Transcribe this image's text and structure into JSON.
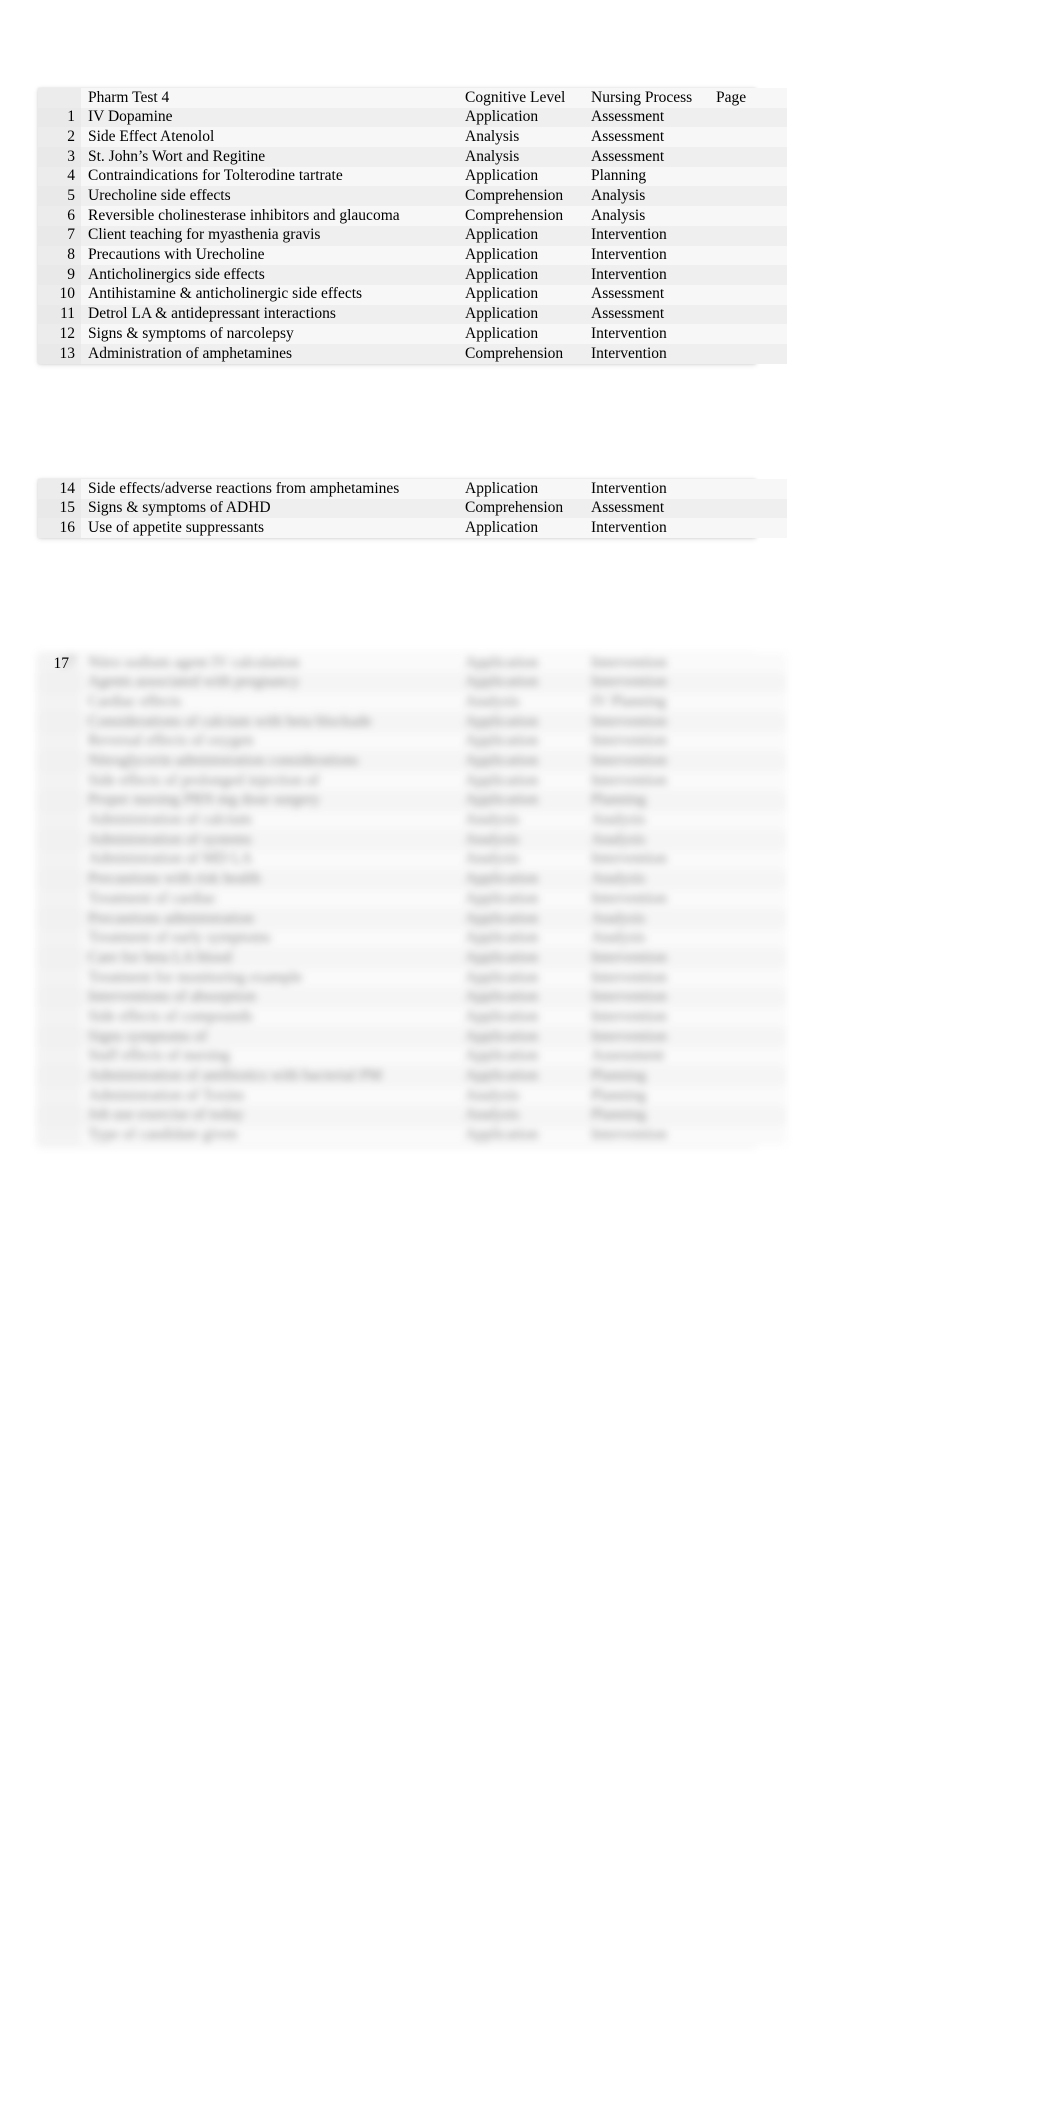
{
  "document": {
    "columns": [
      "",
      "Pharm Test 4",
      "Cognitive Level",
      "Nursing Process",
      "Page"
    ],
    "header": {
      "num": "",
      "title": "Pharm Test 4",
      "cognitive": "Cognitive Level",
      "nursing": "Nursing Process",
      "page": "Page"
    }
  },
  "table1": {
    "rows": [
      {
        "num": "1",
        "item": "IV Dopamine",
        "cognitive": "Application",
        "nursing": "Assessment",
        "page": ""
      },
      {
        "num": "2",
        "item": "Side Effect Atenolol",
        "cognitive": "Analysis",
        "nursing": "Assessment",
        "page": ""
      },
      {
        "num": "3",
        "item": "St. John’s Wort and Regitine",
        "cognitive": "Analysis",
        "nursing": "Assessment",
        "page": ""
      },
      {
        "num": "4",
        "item": "Contraindications for Tolterodine tartrate",
        "cognitive": "Application",
        "nursing": "Planning",
        "page": ""
      },
      {
        "num": "5",
        "item": "Urecholine side effects",
        "cognitive": "Comprehension",
        "nursing": "Analysis",
        "page": ""
      },
      {
        "num": "6",
        "item": "Reversible cholinesterase inhibitors and glaucoma",
        "cognitive": "Comprehension",
        "nursing": "Analysis",
        "page": ""
      },
      {
        "num": "7",
        "item": "Client teaching for myasthenia gravis",
        "cognitive": "Application",
        "nursing": "Intervention",
        "page": ""
      },
      {
        "num": "8",
        "item": "Precautions with Urecholine",
        "cognitive": "Application",
        "nursing": "Intervention",
        "page": ""
      },
      {
        "num": "9",
        "item": "Anticholinergics side effects",
        "cognitive": "Application",
        "nursing": "Intervention",
        "page": ""
      },
      {
        "num": "10",
        "item": "Antihistamine & anticholinergic side effects",
        "cognitive": "Application",
        "nursing": "Assessment",
        "page": ""
      },
      {
        "num": "11",
        "item": "Detrol LA & antidepressant interactions",
        "cognitive": "Application",
        "nursing": "Assessment",
        "page": ""
      },
      {
        "num": "12",
        "item": "Signs & symptoms of narcolepsy",
        "cognitive": "Application",
        "nursing": "Intervention",
        "page": ""
      },
      {
        "num": "13",
        "item": "Administration of amphetamines",
        "cognitive": "Comprehension",
        "nursing": "Intervention",
        "page": ""
      }
    ]
  },
  "table2": {
    "rows": [
      {
        "num": "14",
        "item": "Side effects/adverse reactions from amphetamines",
        "cognitive": "Application",
        "nursing": "Intervention",
        "page": ""
      },
      {
        "num": "15",
        "item": "Signs & symptoms of ADHD",
        "cognitive": "Comprehension",
        "nursing": "Assessment",
        "page": ""
      },
      {
        "num": "16",
        "item": "Use of appetite suppressants",
        "cognitive": "Application",
        "nursing": "Intervention",
        "page": ""
      }
    ]
  },
  "table3": {
    "note": "blurred",
    "first_visible_num": "17",
    "rows": [
      {
        "num": "17",
        "item": "Nitro sodium agent IV calculation",
        "cognitive": "Application",
        "nursing": "Intervention",
        "page": ""
      },
      {
        "num": "",
        "item": "Agents associated with pregnancy",
        "cognitive": "Application",
        "nursing": "Intervention",
        "page": ""
      },
      {
        "num": "",
        "item": "Cardiac effects",
        "cognitive": "Analysis",
        "nursing": "IV Planning",
        "page": ""
      },
      {
        "num": "",
        "item": "Considerations of calcium with beta blockade",
        "cognitive": "Application",
        "nursing": "Intervention",
        "page": ""
      },
      {
        "num": "",
        "item": "Reversal effects of oxygen",
        "cognitive": "Application",
        "nursing": "Intervention",
        "page": ""
      },
      {
        "num": "",
        "item": "Nitroglycerin administration considerations",
        "cognitive": "Application",
        "nursing": "Intervention",
        "page": ""
      },
      {
        "num": "",
        "item": "Side effects of prolonged injection of",
        "cognitive": "Application",
        "nursing": "Intervention",
        "page": ""
      },
      {
        "num": "",
        "item": "Proper nursing PRN mg dose surgery",
        "cognitive": "Application",
        "nursing": "Planning",
        "page": ""
      },
      {
        "num": "",
        "item": "Administration of calcium",
        "cognitive": "Analysis",
        "nursing": "Analysis",
        "page": ""
      },
      {
        "num": "",
        "item": "Administration of systems",
        "cognitive": "Analysis",
        "nursing": "Analysis",
        "page": ""
      },
      {
        "num": "",
        "item": "Administration of MD LA",
        "cognitive": "Analysis",
        "nursing": "Intervention",
        "page": ""
      },
      {
        "num": "",
        "item": "Precautions with risk health",
        "cognitive": "Application",
        "nursing": "Analysis",
        "page": ""
      },
      {
        "num": "",
        "item": "Treatment of cardiac",
        "cognitive": "Application",
        "nursing": "Intervention",
        "page": ""
      },
      {
        "num": "",
        "item": "Precautions administration",
        "cognitive": "Application",
        "nursing": "Analysis",
        "page": ""
      },
      {
        "num": "",
        "item": "Treatment of early symptoms",
        "cognitive": "Application",
        "nursing": "Analysis",
        "page": ""
      },
      {
        "num": "",
        "item": "Care for beta LA blood",
        "cognitive": "Application",
        "nursing": "Intervention",
        "page": ""
      },
      {
        "num": "",
        "item": "Treatment for monitoring example",
        "cognitive": "Application",
        "nursing": "Intervention",
        "page": ""
      },
      {
        "num": "",
        "item": "Interventions of absorption",
        "cognitive": "Application",
        "nursing": "Intervention",
        "page": ""
      },
      {
        "num": "",
        "item": "Side effects of compounds",
        "cognitive": "Application",
        "nursing": "Intervention",
        "page": ""
      },
      {
        "num": "",
        "item": "Signs symptoms of",
        "cognitive": "Application",
        "nursing": "Intervention",
        "page": ""
      },
      {
        "num": "",
        "item": "Staff effects of nursing",
        "cognitive": "Application",
        "nursing": "Assessment",
        "page": ""
      },
      {
        "num": "",
        "item": "Administration of antibiotics with bacterial PM",
        "cognitive": "Application",
        "nursing": "Planning",
        "page": ""
      },
      {
        "num": "",
        "item": "Administration of Toxins",
        "cognitive": "Analysis",
        "nursing": "Planning",
        "page": ""
      },
      {
        "num": "",
        "item": "Job use exercise of today",
        "cognitive": "Analysis",
        "nursing": "Planning",
        "page": ""
      },
      {
        "num": "",
        "item": "Type of candidate given",
        "cognitive": "Application",
        "nursing": "Intervention",
        "page": ""
      }
    ]
  }
}
